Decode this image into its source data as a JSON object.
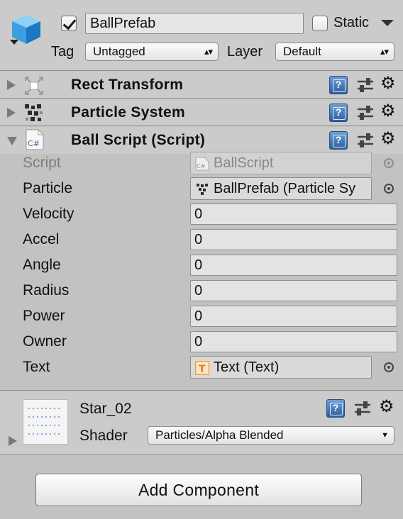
{
  "header": {
    "object_name": "BallPrefab",
    "active_checked": true,
    "static_label": "Static",
    "static_checked": false,
    "tag_label": "Tag",
    "tag_value": "Untagged",
    "layer_label": "Layer",
    "layer_value": "Default"
  },
  "components": [
    {
      "title": "Rect Transform",
      "expanded": false,
      "icon": "rect-transform-icon"
    },
    {
      "title": "Particle System",
      "expanded": false,
      "icon": "particle-system-icon"
    },
    {
      "title": "Ball Script (Script)",
      "expanded": true,
      "icon": "csharp-script-icon"
    }
  ],
  "script_fields": {
    "script_label": "Script",
    "script_value": "BallScript",
    "particle_label": "Particle",
    "particle_value": "BallPrefab (Particle Sy",
    "velocity_label": "Velocity",
    "velocity_value": "0",
    "accel_label": "Accel",
    "accel_value": "0",
    "angle_label": "Angle",
    "angle_value": "0",
    "radius_label": "Radius",
    "radius_value": "0",
    "power_label": "Power",
    "power_value": "0",
    "owner_label": "Owner",
    "owner_value": "0",
    "text_label": "Text",
    "text_value": "Text (Text)"
  },
  "material": {
    "name": "Star_02",
    "shader_label": "Shader",
    "shader_value": "Particles/Alpha Blended"
  },
  "add_component_label": "Add Component",
  "colors": {
    "panel_bg": "#c2c2c2",
    "header_bg": "#cbcbcb",
    "help_icon_blue": "#2d5f9e",
    "text_icon_orange": "#f39a2b"
  }
}
